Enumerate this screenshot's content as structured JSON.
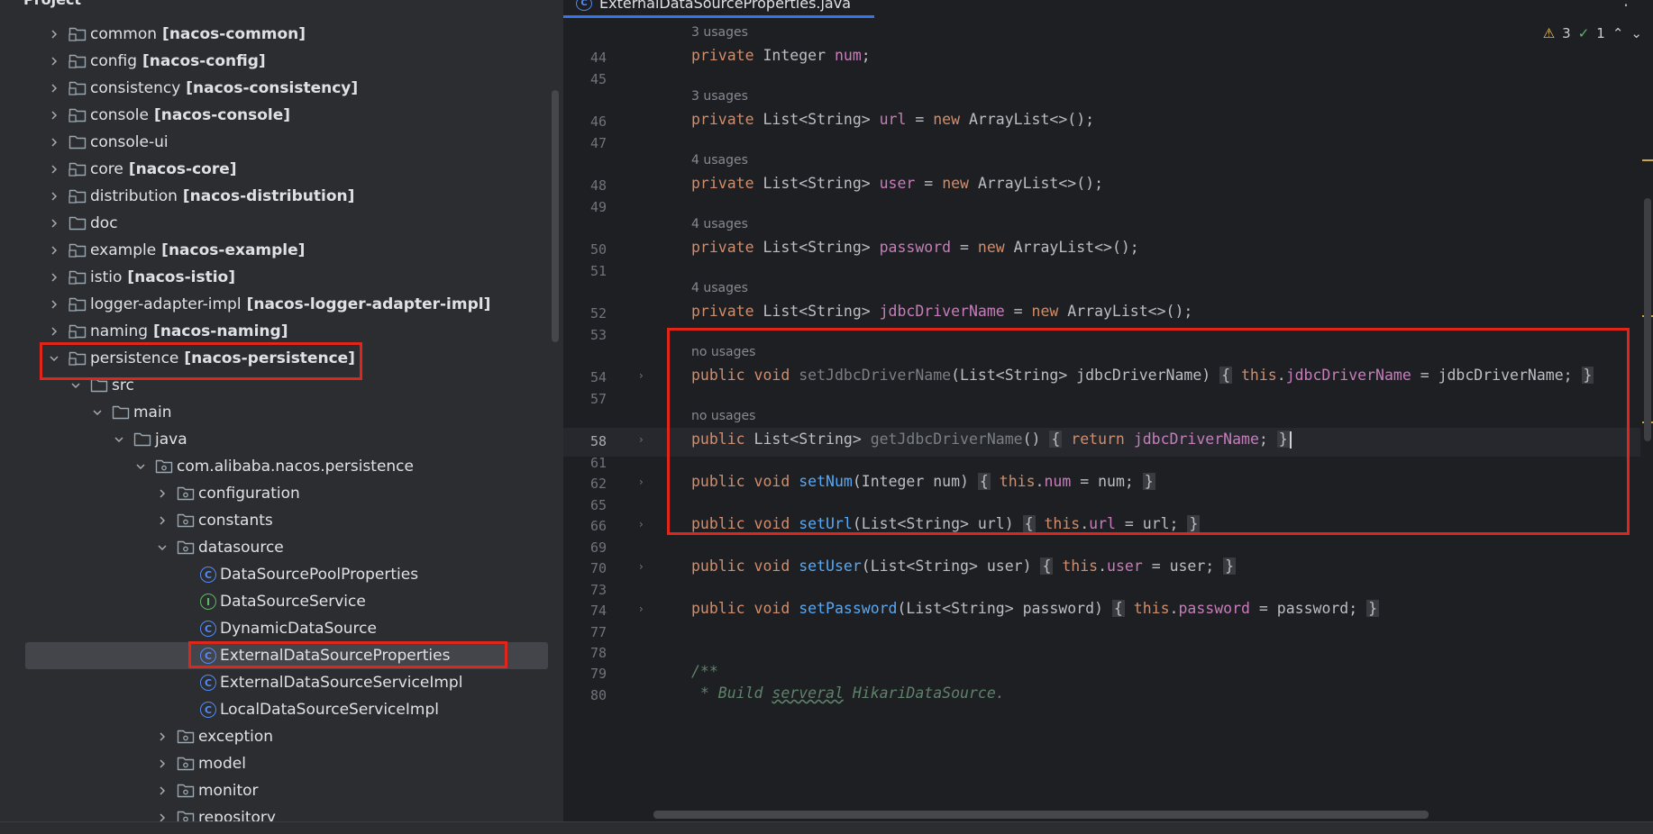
{
  "project_panel": {
    "title": "Project",
    "rows": [
      {
        "name": "common",
        "module": "[nacos-common]",
        "depth": 0,
        "state": "collapsed",
        "kind": "module"
      },
      {
        "name": "config",
        "module": "[nacos-config]",
        "depth": 0,
        "state": "collapsed",
        "kind": "module"
      },
      {
        "name": "consistency",
        "module": "[nacos-consistency]",
        "depth": 0,
        "state": "collapsed",
        "kind": "module"
      },
      {
        "name": "console",
        "module": "[nacos-console]",
        "depth": 0,
        "state": "collapsed",
        "kind": "module"
      },
      {
        "name": "console-ui",
        "module": "",
        "depth": 0,
        "state": "collapsed",
        "kind": "folder"
      },
      {
        "name": "core",
        "module": "[nacos-core]",
        "depth": 0,
        "state": "collapsed",
        "kind": "module"
      },
      {
        "name": "distribution",
        "module": "[nacos-distribution]",
        "depth": 0,
        "state": "collapsed",
        "kind": "module"
      },
      {
        "name": "doc",
        "module": "",
        "depth": 0,
        "state": "collapsed",
        "kind": "folder"
      },
      {
        "name": "example",
        "module": "[nacos-example]",
        "depth": 0,
        "state": "collapsed",
        "kind": "module"
      },
      {
        "name": "istio",
        "module": "[nacos-istio]",
        "depth": 0,
        "state": "collapsed",
        "kind": "module"
      },
      {
        "name": "logger-adapter-impl",
        "module": "[nacos-logger-adapter-impl]",
        "depth": 0,
        "state": "collapsed",
        "kind": "module"
      },
      {
        "name": "naming",
        "module": "[nacos-naming]",
        "depth": 0,
        "state": "collapsed",
        "kind": "module"
      },
      {
        "name": "persistence",
        "module": "[nacos-persistence]",
        "depth": 0,
        "state": "expanded",
        "kind": "module"
      },
      {
        "name": "src",
        "module": "",
        "depth": 1,
        "state": "expanded",
        "kind": "folder"
      },
      {
        "name": "main",
        "module": "",
        "depth": 2,
        "state": "expanded",
        "kind": "folder"
      },
      {
        "name": "java",
        "module": "",
        "depth": 3,
        "state": "expanded",
        "kind": "source"
      },
      {
        "name": "com.alibaba.nacos.persistence",
        "module": "",
        "depth": 4,
        "state": "expanded",
        "kind": "package"
      },
      {
        "name": "configuration",
        "module": "",
        "depth": 5,
        "state": "collapsed",
        "kind": "package"
      },
      {
        "name": "constants",
        "module": "",
        "depth": 5,
        "state": "collapsed",
        "kind": "package"
      },
      {
        "name": "datasource",
        "module": "",
        "depth": 5,
        "state": "expanded",
        "kind": "package"
      },
      {
        "name": "DataSourcePoolProperties",
        "module": "",
        "depth": 6,
        "state": "leaf",
        "kind": "class"
      },
      {
        "name": "DataSourceService",
        "module": "",
        "depth": 6,
        "state": "leaf",
        "kind": "interface"
      },
      {
        "name": "DynamicDataSource",
        "module": "",
        "depth": 6,
        "state": "leaf",
        "kind": "class"
      },
      {
        "name": "ExternalDataSourceProperties",
        "module": "",
        "depth": 6,
        "state": "leaf",
        "kind": "class",
        "selected": true
      },
      {
        "name": "ExternalDataSourceServiceImpl",
        "module": "",
        "depth": 6,
        "state": "leaf",
        "kind": "class"
      },
      {
        "name": "LocalDataSourceServiceImpl",
        "module": "",
        "depth": 6,
        "state": "leaf",
        "kind": "class"
      },
      {
        "name": "exception",
        "module": "",
        "depth": 5,
        "state": "collapsed",
        "kind": "package"
      },
      {
        "name": "model",
        "module": "",
        "depth": 5,
        "state": "collapsed",
        "kind": "package"
      },
      {
        "name": "monitor",
        "module": "",
        "depth": 5,
        "state": "collapsed",
        "kind": "package"
      },
      {
        "name": "repository",
        "module": "",
        "depth": 5,
        "state": "collapsed",
        "kind": "package"
      }
    ]
  },
  "editor": {
    "tab_label": "ExternalDataSourceProperties.java",
    "inspections": {
      "warnings": "3",
      "weak": "1"
    },
    "lines": [
      {
        "usages": "3 usages",
        "num": "44",
        "code": [
          [
            "kw",
            "private "
          ],
          [
            "t",
            "Integer "
          ],
          [
            "fld",
            "num"
          ],
          [
            "t",
            ";"
          ]
        ]
      },
      {
        "num": "45",
        "code": []
      },
      {
        "usages": "3 usages",
        "num": "46",
        "code": [
          [
            "kw",
            "private "
          ],
          [
            "t",
            "List<String> "
          ],
          [
            "fld",
            "url"
          ],
          [
            "t",
            " = "
          ],
          [
            "kw",
            "new "
          ],
          [
            "t",
            "ArrayList<>();"
          ]
        ]
      },
      {
        "num": "47",
        "code": []
      },
      {
        "usages": "4 usages",
        "num": "48",
        "code": [
          [
            "kw",
            "private "
          ],
          [
            "t",
            "List<String> "
          ],
          [
            "fld",
            "user"
          ],
          [
            "t",
            " = "
          ],
          [
            "kw",
            "new "
          ],
          [
            "t",
            "ArrayList<>();"
          ]
        ]
      },
      {
        "num": "49",
        "code": []
      },
      {
        "usages": "4 usages",
        "num": "50",
        "code": [
          [
            "kw",
            "private "
          ],
          [
            "t",
            "List<String> "
          ],
          [
            "fld",
            "password"
          ],
          [
            "t",
            " = "
          ],
          [
            "kw",
            "new "
          ],
          [
            "t",
            "ArrayList<>();"
          ]
        ]
      },
      {
        "num": "51",
        "code": []
      },
      {
        "usages": "4 usages",
        "num": "52",
        "code": [
          [
            "kw",
            "private "
          ],
          [
            "t",
            "List<String> "
          ],
          [
            "fld",
            "jdbcDriverName"
          ],
          [
            "t",
            " = "
          ],
          [
            "kw",
            "new "
          ],
          [
            "t",
            "ArrayList<>();"
          ]
        ]
      },
      {
        "num": "53",
        "code": []
      },
      {
        "usages": "no usages",
        "num": "54",
        "fold": true,
        "code": [
          [
            "kw",
            "public void "
          ],
          [
            "dim",
            "setJdbcDriverName"
          ],
          [
            "t",
            "(List<String> jdbcDriverName) "
          ],
          [
            "br",
            "{"
          ],
          [
            "t",
            " "
          ],
          [
            "kw",
            "this"
          ],
          [
            "t",
            "."
          ],
          [
            "fld",
            "jdbcDriverName"
          ],
          [
            "t",
            " = jdbcDriverName; "
          ],
          [
            "br",
            "}"
          ]
        ]
      },
      {
        "num": "57",
        "code": []
      },
      {
        "usages": "no usages",
        "num": "58",
        "fold": true,
        "current": true,
        "code": [
          [
            "kw",
            "public "
          ],
          [
            "t",
            "List<String> "
          ],
          [
            "dim",
            "getJdbcDriverName"
          ],
          [
            "t",
            "() "
          ],
          [
            "br",
            "{"
          ],
          [
            "t",
            " "
          ],
          [
            "kw",
            "return "
          ],
          [
            "fld",
            "jdbcDriverName"
          ],
          [
            "t",
            "; "
          ],
          [
            "br",
            "}"
          ],
          [
            "cur",
            ""
          ]
        ]
      },
      {
        "num": "61",
        "code": []
      },
      {
        "num": "62",
        "fold": true,
        "code": [
          [
            "kw",
            "public void "
          ],
          [
            "mth",
            "setNum"
          ],
          [
            "t",
            "(Integer num) "
          ],
          [
            "br",
            "{"
          ],
          [
            "t",
            " "
          ],
          [
            "kw",
            "this"
          ],
          [
            "t",
            "."
          ],
          [
            "fld",
            "num"
          ],
          [
            "t",
            " = num; "
          ],
          [
            "br",
            "}"
          ]
        ]
      },
      {
        "num": "65",
        "code": []
      },
      {
        "num": "66",
        "fold": true,
        "code": [
          [
            "kw",
            "public void "
          ],
          [
            "mth",
            "setUrl"
          ],
          [
            "t",
            "(List<String> url) "
          ],
          [
            "br",
            "{"
          ],
          [
            "t",
            " "
          ],
          [
            "kw",
            "this"
          ],
          [
            "t",
            "."
          ],
          [
            "fld",
            "url"
          ],
          [
            "t",
            " = url; "
          ],
          [
            "br",
            "}"
          ]
        ]
      },
      {
        "num": "69",
        "code": []
      },
      {
        "num": "70",
        "fold": true,
        "code": [
          [
            "kw",
            "public void "
          ],
          [
            "mth",
            "setUser"
          ],
          [
            "t",
            "(List<String> user) "
          ],
          [
            "br",
            "{"
          ],
          [
            "t",
            " "
          ],
          [
            "kw",
            "this"
          ],
          [
            "t",
            "."
          ],
          [
            "fld",
            "user"
          ],
          [
            "t",
            " = user; "
          ],
          [
            "br",
            "}"
          ]
        ]
      },
      {
        "num": "73",
        "code": []
      },
      {
        "num": "74",
        "fold": true,
        "code": [
          [
            "kw",
            "public void "
          ],
          [
            "mth",
            "setPassword"
          ],
          [
            "t",
            "(List<String> password) "
          ],
          [
            "br",
            "{"
          ],
          [
            "t",
            " "
          ],
          [
            "kw",
            "this"
          ],
          [
            "t",
            "."
          ],
          [
            "fld",
            "password"
          ],
          [
            "t",
            " = password; "
          ],
          [
            "br",
            "}"
          ]
        ]
      },
      {
        "num": "77",
        "code": []
      },
      {
        "num": "78",
        "code": []
      },
      {
        "num": "79",
        "code": [
          [
            "cmt",
            "/**"
          ]
        ]
      },
      {
        "num": "80",
        "code": [
          [
            "cmt",
            " * Build "
          ],
          [
            "cmtu",
            "serveral"
          ],
          [
            "cmt",
            " HikariDataSource."
          ]
        ]
      }
    ]
  },
  "colors": {
    "highlight_box": "#e0251b",
    "selection_bg": "#43454a",
    "accent": "#3574f0"
  }
}
